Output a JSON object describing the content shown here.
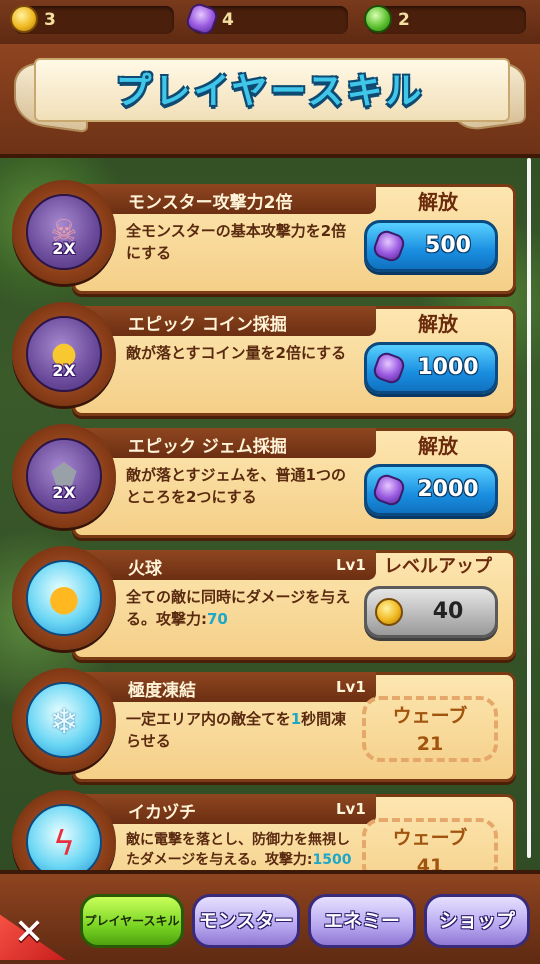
{
  "currency": {
    "coins": "3",
    "gems": "4",
    "emeralds": "2"
  },
  "header": {
    "title": "プレイヤースキル"
  },
  "skills": [
    {
      "name": "モンスター攻撃力2倍",
      "level": "",
      "desc": "全モンスターの基本攻撃力を2倍にする",
      "icon_tag": "2X",
      "icon": "pig-skull-icon",
      "action_label": "解放",
      "cost": "500",
      "currency": "gem"
    },
    {
      "name": "エピック コイン採掘",
      "level": "",
      "desc": "敵が落とすコイン量を2倍にする",
      "icon_tag": "2X",
      "icon": "coin-icon",
      "action_label": "解放",
      "cost": "1000",
      "currency": "gem"
    },
    {
      "name": "エピック ジェム採掘",
      "level": "",
      "desc": "敵が落とすジェムを、普通1つのところを2つにする",
      "icon_tag": "2X",
      "icon": "gem-rock-icon",
      "action_label": "解放",
      "cost": "2000",
      "currency": "gem"
    },
    {
      "name": "火球",
      "level": "Lv1",
      "desc": "全ての敵に同時にダメージを与える。攻撃力:",
      "desc_value": "70",
      "icon": "fireball-icon",
      "action_label": "レベルアップ",
      "cost": "40",
      "currency": "coin"
    },
    {
      "name": "極度凍結",
      "level": "Lv1",
      "desc_a": "一定エリア内の敵全てを",
      "desc_value": "1",
      "desc_b": "秒間凍らせる",
      "icon": "ice-crystal-icon",
      "wave_label": "ウェーブ",
      "wave_num": "21"
    },
    {
      "name": "イカヅチ",
      "level": "Lv1",
      "desc": "敵に電撃を落とし、防御力を無視したダメージを与える。攻撃力:",
      "desc_value": "1500",
      "icon": "lightning-icon",
      "wave_label": "ウェーブ",
      "wave_num": "41"
    }
  ],
  "tabs": [
    {
      "label": "プレイヤースキル",
      "active": true
    },
    {
      "label": "モンスター",
      "active": false
    },
    {
      "label": "エネミー",
      "active": false
    },
    {
      "label": "ショップ",
      "active": false
    }
  ],
  "close_label": "✕"
}
